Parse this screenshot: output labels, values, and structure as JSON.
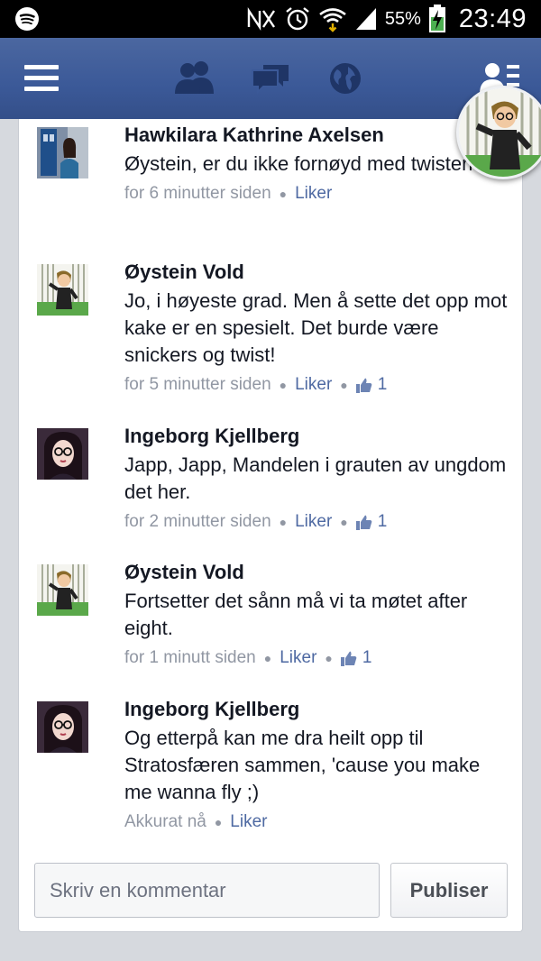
{
  "status_bar": {
    "battery_percent": "55%",
    "time": "23:49",
    "icons": [
      "spotify-icon",
      "nfc-icon",
      "alarm-icon",
      "wifi-icon",
      "signal-icon",
      "battery-charging-icon"
    ]
  },
  "topbar": {
    "icons": [
      "menu-icon",
      "friend-requests-icon",
      "messages-icon",
      "notifications-globe-icon",
      "friends-list-icon"
    ],
    "color": "#3b5998"
  },
  "comments": [
    {
      "author": "Hawkilara Kathrine Axelsen",
      "text": "Øystein, er du ikke fornøyd med twisten?:P",
      "time": "for 6 minutter siden",
      "like_label": "Liker",
      "likes": null
    },
    {
      "author": "Øystein Vold",
      "text": "Jo, i høyeste grad. Men å sette det opp mot kake er en spesielt. Det burde være snickers og twist!",
      "time": "for 5 minutter siden",
      "like_label": "Liker",
      "likes": "1"
    },
    {
      "author": "Ingeborg Kjellberg",
      "text": "Japp, Japp, Mandelen i grauten av ungdom det her.",
      "time": "for 2 minutter siden",
      "like_label": "Liker",
      "likes": "1"
    },
    {
      "author": "Øystein Vold",
      "text": "Fortsetter det sånn må vi ta møtet after eight.",
      "time": "for 1 minutt siden",
      "like_label": "Liker",
      "likes": "1"
    },
    {
      "author": "Ingeborg Kjellberg",
      "text": "Og etterpå kan me dra heilt opp til Stratosfæren sammen, 'cause you make me wanna fly ;)",
      "time": "Akkurat nå",
      "like_label": "Liker",
      "likes": null
    }
  ],
  "composer": {
    "placeholder": "Skriv en kommentar",
    "value": "",
    "publish_label": "Publiser"
  },
  "colors": {
    "link": "#4e69a2",
    "meta": "#9197a3",
    "text": "#141823"
  }
}
